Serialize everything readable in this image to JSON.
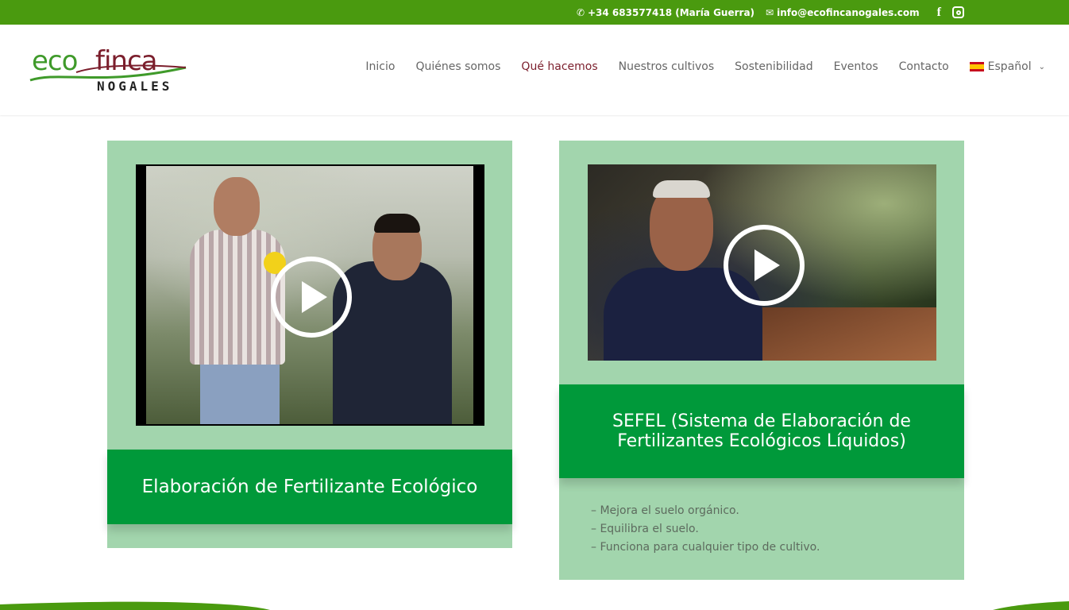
{
  "topbar": {
    "phone": "+34 683577418 (María Guerra)",
    "email": "info@ecofincanogales.com",
    "phone_icon": "phone-icon",
    "email_icon": "envelope-icon",
    "social": [
      "facebook-icon",
      "instagram-icon"
    ]
  },
  "logo": {
    "eco": "eco",
    "finca": "finca",
    "nogales": "NOGALES"
  },
  "nav": {
    "items": [
      {
        "label": "Inicio"
      },
      {
        "label": "Quiénes somos"
      },
      {
        "label": "Qué hacemos",
        "active": true
      },
      {
        "label": "Nuestros cultivos"
      },
      {
        "label": "Sostenibilidad"
      },
      {
        "label": "Eventos"
      },
      {
        "label": "Contacto"
      }
    ],
    "language": "Español"
  },
  "cards": [
    {
      "title": "Elaboración de Fertilizante Ecológico"
    },
    {
      "title": "SEFEL (Sistema de Elaboración de Fertilizantes Ecológicos Líquidos)",
      "bullets": [
        "– Mejora el suelo orgánico.",
        "– Equilibra el suelo.",
        "– Funciona para cualquier tipo de cultivo."
      ]
    }
  ],
  "colors": {
    "topbar": "#4a9a0f",
    "active_nav": "#7b1e2c",
    "card_bg": "#a2d5ad",
    "title_band": "#00993a"
  }
}
